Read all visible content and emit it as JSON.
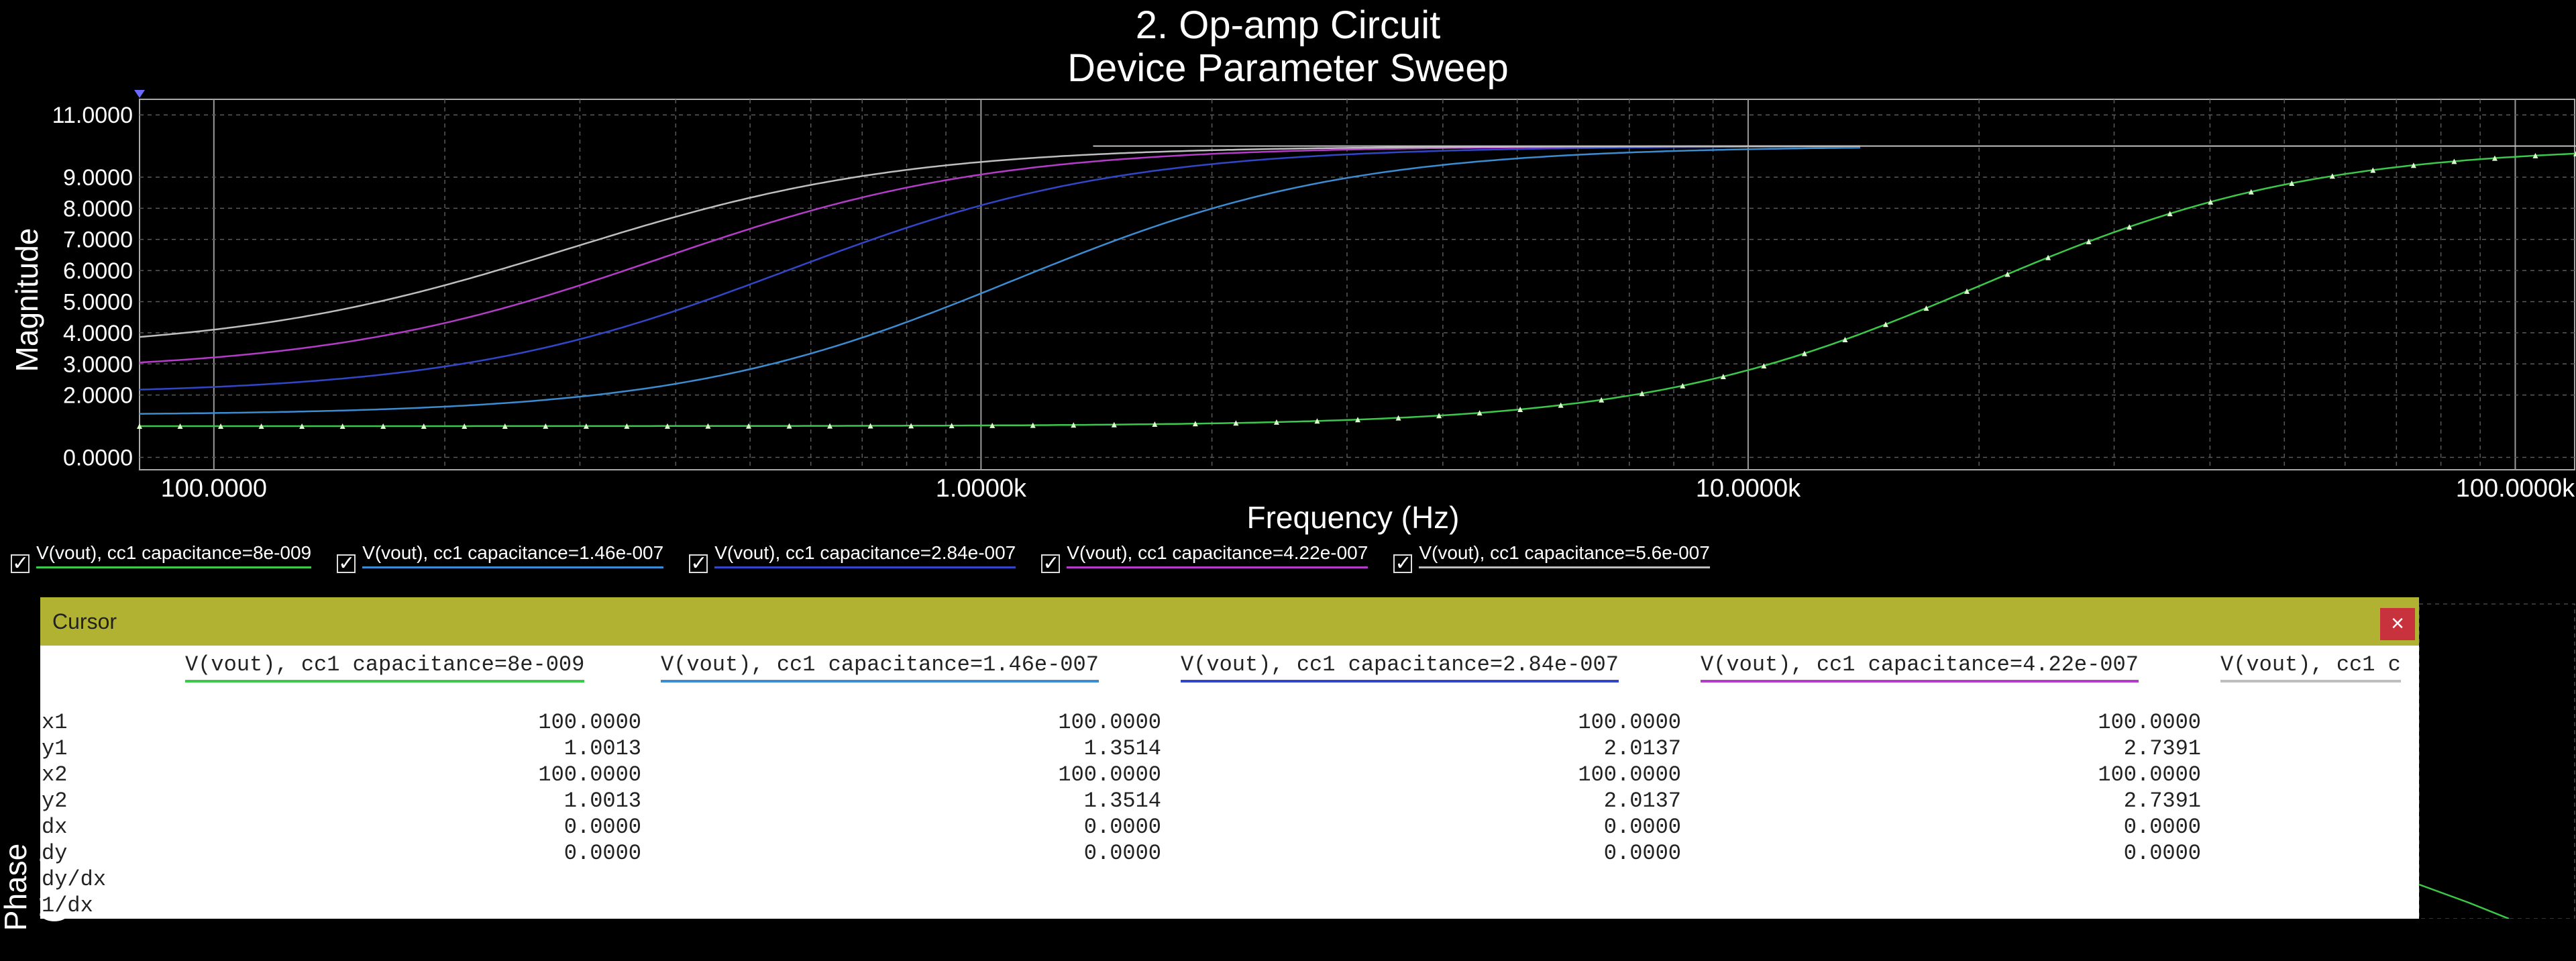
{
  "chart_data": {
    "type": "line",
    "title": "2. Op-amp Circuit",
    "subtitle": "Device Parameter Sweep",
    "xlabel": "Frequency (Hz)",
    "ylabel": "Magnitude",
    "ylabel2": "Phase (deg)",
    "xscale": "log",
    "xlim": [
      80,
      120000
    ],
    "ylim": [
      -0.4,
      11.5
    ],
    "grid": true,
    "x_ticks": [
      "100.0000",
      "1.0000k",
      "10.0000k",
      "100.0000k"
    ],
    "y_ticks": [
      "0.0000",
      "2.0000",
      "3.0000",
      "4.0000",
      "5.0000",
      "6.0000",
      "7.0000",
      "8.0000",
      "9.0000",
      "11.0000"
    ],
    "series": [
      {
        "name": "V(vout), cc1 capacitance=8e-009",
        "color": "#3cc84a",
        "fc": 20000,
        "y0": 1.0013,
        "marker": "triangle"
      },
      {
        "name": "V(vout), cc1 capacitance=1.46e-007",
        "color": "#3c8cd2",
        "fc": 1100,
        "y0": 1.3514
      },
      {
        "name": "V(vout), cc1 capacitance=2.84e-007",
        "color": "#3246c8",
        "fc": 560,
        "y0": 2.0137
      },
      {
        "name": "V(vout), cc1 capacitance=4.22e-007",
        "color": "#b43cc8",
        "fc": 380,
        "y0": 2.7391
      },
      {
        "name": "V(vout), cc1 capacitance=5.6e-007",
        "color": "#bebebe",
        "fc": 290,
        "y0": 3.4
      }
    ],
    "y_final": 10.0
  },
  "legend_check": "✓",
  "cursor": {
    "title": "Cursor",
    "close": "×",
    "row_labels": [
      "x1",
      "y1",
      "x2",
      "y2",
      "dx",
      "dy",
      "dy/dx",
      "1/dx"
    ],
    "columns": [
      {
        "header": "V(vout), cc1 capacitance=8e-009",
        "color": "#3cc84a",
        "values": [
          "100.0000",
          "1.0013",
          "100.0000",
          "1.0013",
          "0.0000",
          "0.0000"
        ]
      },
      {
        "header": "V(vout), cc1 capacitance=1.46e-007",
        "color": "#3c8cd2",
        "values": [
          "100.0000",
          "1.3514",
          "100.0000",
          "1.3514",
          "0.0000",
          "0.0000"
        ]
      },
      {
        "header": "V(vout), cc1 capacitance=2.84e-007",
        "color": "#3246c8",
        "values": [
          "100.0000",
          "2.0137",
          "100.0000",
          "2.0137",
          "0.0000",
          "0.0000"
        ]
      },
      {
        "header": "V(vout), cc1 capacitance=4.22e-007",
        "color": "#b43cc8",
        "values": [
          "100.0000",
          "2.7391",
          "100.0000",
          "2.7391",
          "0.0000",
          "0.0000"
        ]
      },
      {
        "header": "V(vout), cc1 c",
        "color": "#bebebe",
        "values": []
      }
    ]
  }
}
